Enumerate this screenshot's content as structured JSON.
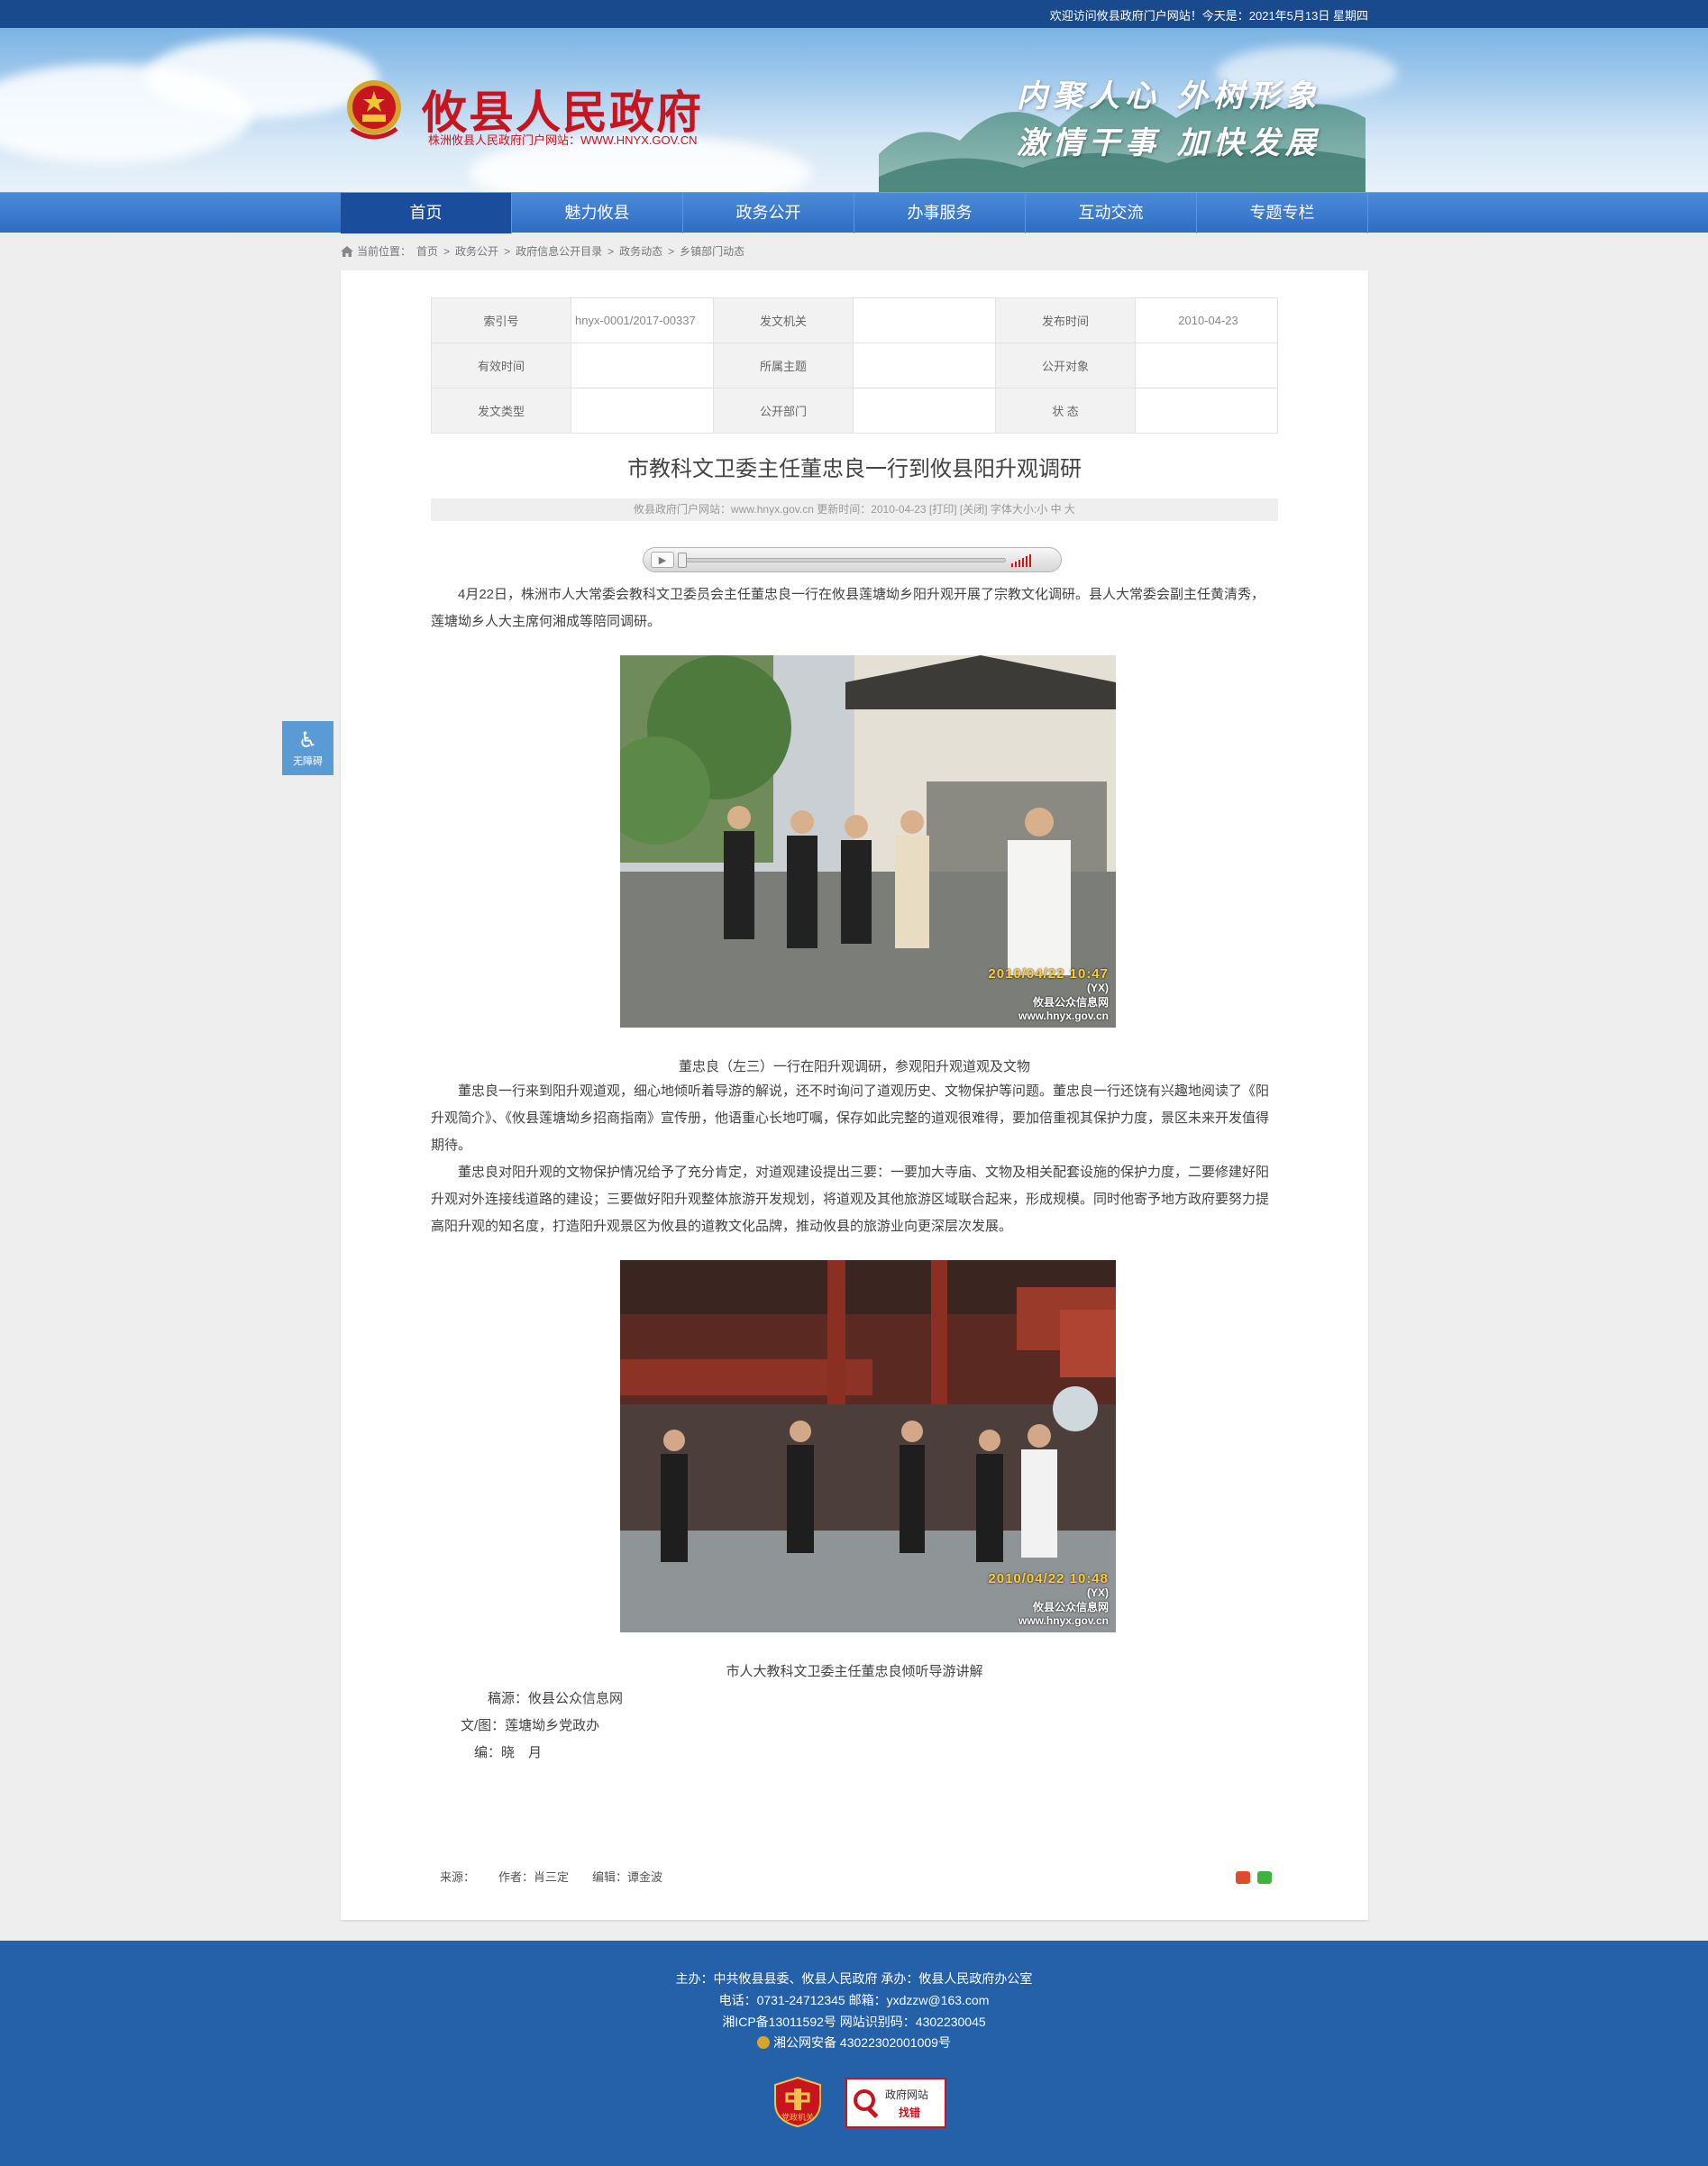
{
  "topbar": {
    "welcome": "欢迎访问攸县政府门户网站！今天是：2021年5月13日 星期四"
  },
  "header": {
    "title": "攸县人民政府",
    "subtitle": "株洲攸县人民政府门户网站：WWW.HNYX.GOV.CN",
    "slogan_line1": "内聚人心 外树形象",
    "slogan_line2": "激情干事 加快发展"
  },
  "nav": {
    "items": [
      "首页",
      "魅力攸县",
      "政务公开",
      "办事服务",
      "互动交流",
      "专题专栏"
    ],
    "active_index": 0
  },
  "breadcrumb": {
    "label": "当前位置：",
    "items": [
      "首页",
      "政务公开",
      "政府信息公开目录",
      "政务动态",
      "乡镇部门动态"
    ],
    "separator": ">"
  },
  "info_table": {
    "rows": [
      [
        {
          "k": "索引号",
          "v": "hnyx-0001/2017-00337"
        },
        {
          "k": "发文机关",
          "v": ""
        },
        {
          "k": "发布时间",
          "v": "2010-04-23"
        }
      ],
      [
        {
          "k": "有效时间",
          "v": ""
        },
        {
          "k": "所属主题",
          "v": ""
        },
        {
          "k": "公开对象",
          "v": ""
        }
      ],
      [
        {
          "k": "发文类型",
          "v": ""
        },
        {
          "k": "公开部门",
          "v": ""
        },
        {
          "k": "状 态",
          "v": ""
        }
      ]
    ]
  },
  "article": {
    "title": "市教科文卫委主任董忠良一行到攸县阳升观调研",
    "meta": "攸县政府门户网站：www.hnyx.gov.cn   更新时间：2010-04-23   [打印] [关闭]   字体大小:小 中 大",
    "para1": "4月22日，株洲市人大常委会教科文卫委员会主任董忠良一行在攸县莲塘坳乡阳升观开展了宗教文化调研。县人大常委会副主任黄清秀，莲塘坳乡人大主席何湘成等陪同调研。",
    "photo1_stamp_date": "2010/04/22 10:47",
    "photo2_stamp_date": "2010/04/22 10:48",
    "stamp_logo": "(YX)",
    "stamp_site": "攸县公众信息网",
    "stamp_url": "www.hnyx.gov.cn",
    "caption1": "董忠良（左三）一行在阳升观调研，参观阳升观道观及文物",
    "para2": "董忠良一行来到阳升观道观，细心地倾听着导游的解说，还不时询问了道观历史、文物保护等问题。董忠良一行还饶有兴趣地阅读了《阳升观简介》、《攸县莲塘坳乡招商指南》宣传册，他语重心长地叮嘱，保存如此完整的道观很难得，要加倍重视其保护力度，景区未来开发值得期待。",
    "para3": "董忠良对阳升观的文物保护情况给予了充分肯定，对道观建设提出三要：一要加大寺庙、文物及相关配套设施的保护力度，二要修建好阳升观对外连接线道路的建设；三要做好阳升观整体旅游开发规划，将道观及其他旅游区域联合起来，形成规模。同时他寄予地方政府要努力提高阳升观的知名度，打造阳升观景区为攸县的道教文化品牌，推动攸县的旅游业向更深层次发展。",
    "caption2": "市人大教科文卫委主任董忠良倾听导游讲解",
    "credit_source": "稿源：攸县公众信息网",
    "credit_author": "文/图：莲塘坳乡党政办",
    "credit_editor": "编：晓　月"
  },
  "article_footer": {
    "source": "来源：",
    "author": "作者：肖三定",
    "editor": "编辑：谭金波"
  },
  "accessibility": {
    "label": "无障碍"
  },
  "footer": {
    "line1": "主办：中共攸县县委、攸县人民政府 承办：攸县人民政府办公室",
    "line2": "电话：0731-24712345 邮箱：yxdzzw@163.com",
    "line3": "湘ICP备13011592号    网站识别码：4302230045",
    "line4": "湘公网安备 43022302001009号",
    "badge1": "党政机关",
    "badge2_l1": "政府网站",
    "badge2_l2": "找错"
  },
  "colors": {
    "brand_red": "#c8141e",
    "nav_blue": "#2e6dc4",
    "footer_blue": "#2461a9",
    "topbar": "#1a4a8e"
  }
}
